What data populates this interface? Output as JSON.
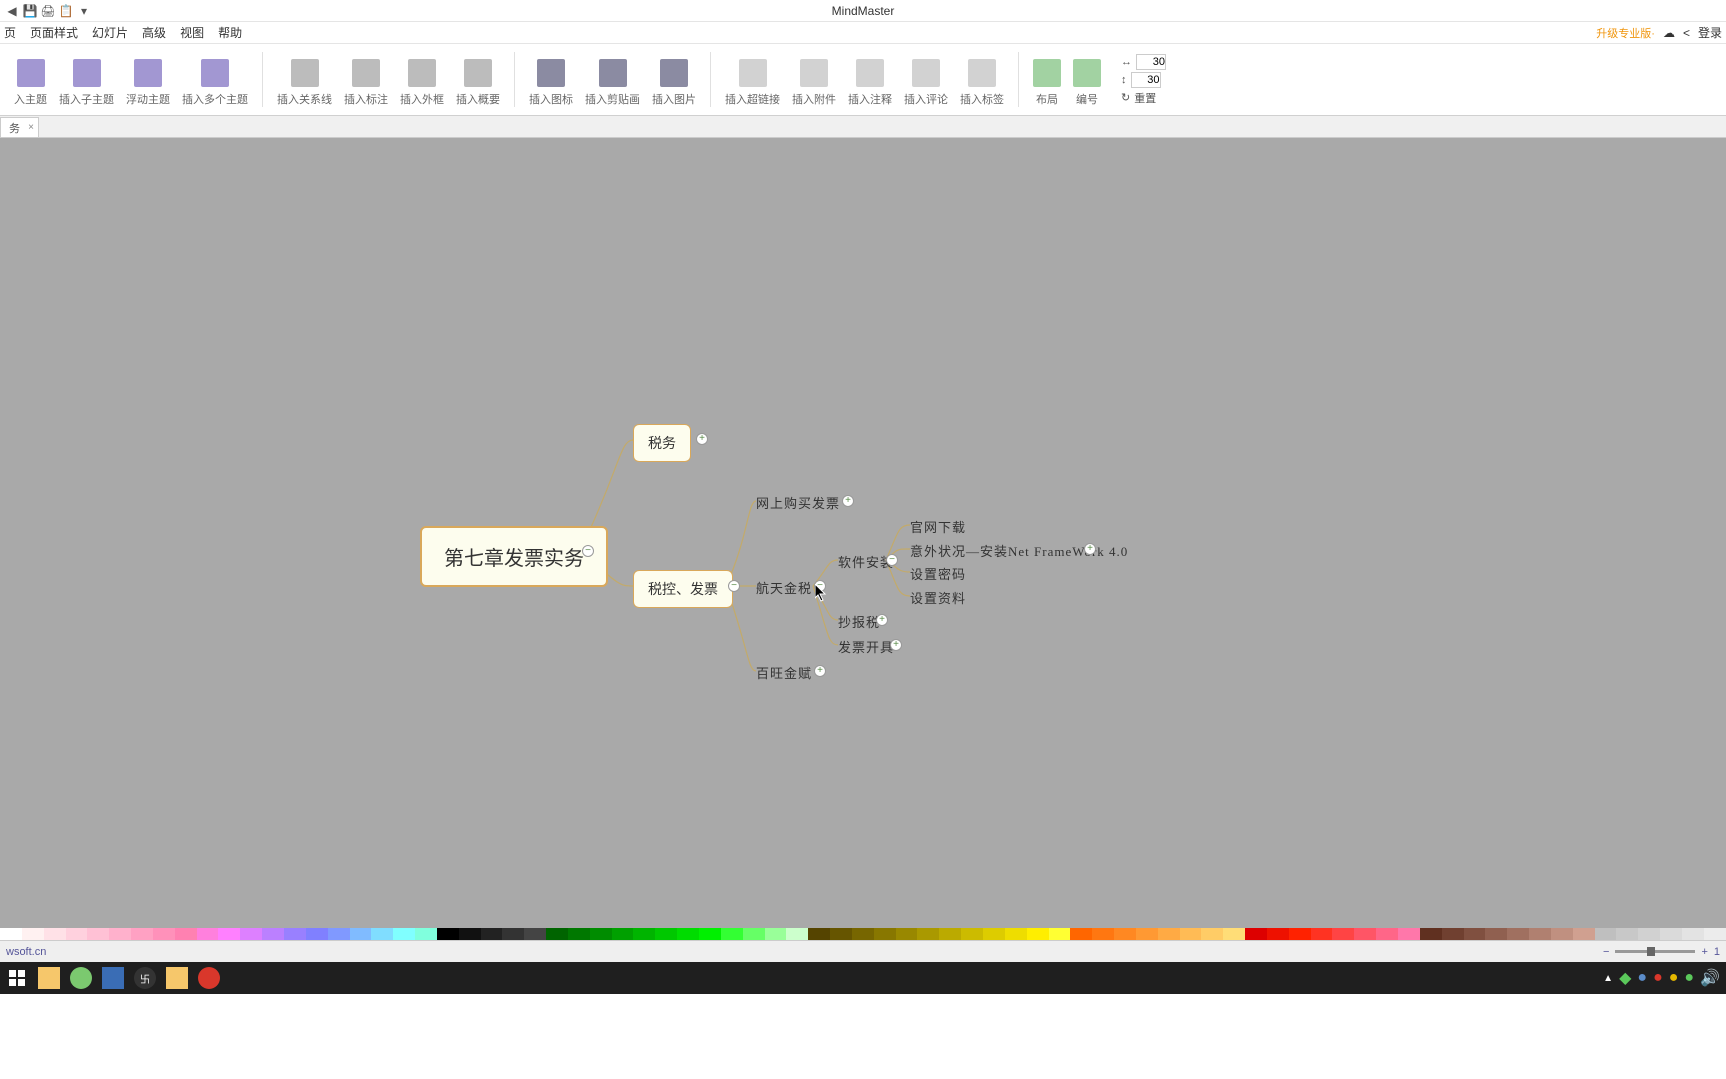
{
  "app": {
    "title": "MindMaster"
  },
  "qat": [
    "◀",
    "💾",
    "🖨",
    "📋",
    "▾"
  ],
  "menu": {
    "items": [
      "页",
      "页面样式",
      "幻灯片",
      "高级",
      "视图",
      "帮助"
    ],
    "upgrade": "升级专业版·",
    "login": "登录"
  },
  "ribbon": {
    "groups": [
      [
        "入主题",
        "插入子主题",
        "浮动主题",
        "插入多个主题"
      ],
      [
        "插入关系线",
        "插入标注",
        "插入外框",
        "插入概要"
      ],
      [
        "插入图标",
        "插入剪贴画",
        "插入图片"
      ],
      [
        "插入超链接",
        "插入附件",
        "插入注释",
        "插入评论",
        "插入标签"
      ],
      [
        "布局",
        "编号"
      ]
    ],
    "spin": {
      "h": "30",
      "v": "30",
      "reset": "重置"
    }
  },
  "tab": {
    "name": "务",
    "close": "×"
  },
  "mindmap": {
    "root": "第七章发票实务",
    "a": "税务",
    "b": "税控、发票",
    "b1": "网上购买发票",
    "b2": "航天金税",
    "b21": "软件安装",
    "b211": "官网下载",
    "b212": "意外状况—安装Net FrameWork 4.0",
    "b213": "设置密码",
    "b214": "设置资料",
    "b22": "抄报税",
    "b23": "发票开具",
    "b3": "百旺金赋"
  },
  "status": {
    "link": "wsoft.cn",
    "zoom": "1"
  },
  "colors": [
    "#fff",
    "#fff1f1",
    "#ffe1e7",
    "#ffd1de",
    "#ffc1d5",
    "#ffb1cc",
    "#ffa1c3",
    "#ff91ba",
    "#ff81b1",
    "#ff80dd",
    "#ff80ff",
    "#dd80ff",
    "#bb80ff",
    "#9980ff",
    "#8080ff",
    "#8099ff",
    "#80bbff",
    "#80ddff",
    "#80ffff",
    "#80ffdd",
    "#000000",
    "#111",
    "#222",
    "#333",
    "#444",
    "#006400",
    "#007800",
    "#008c00",
    "#00a000",
    "#00b400",
    "#00c800",
    "#00dc00",
    "#00f000",
    "#33ff33",
    "#66ff66",
    "#99ff99",
    "#ccffcc",
    "#554400",
    "#665500",
    "#776600",
    "#887700",
    "#998800",
    "#aa9900",
    "#bbaa00",
    "#ccbb00",
    "#ddcc00",
    "#eedd00",
    "#ffee00",
    "#ffff33",
    "#ff6600",
    "#ff7711",
    "#ff8822",
    "#ff9933",
    "#ffaa44",
    "#ffbb55",
    "#ffcc66",
    "#ffdd77",
    "#dd0000",
    "#ee1100",
    "#ff2200",
    "#ff3322",
    "#ff4444",
    "#ff5566",
    "#ff6688",
    "#ff77aa",
    "#603020",
    "#704030",
    "#805040",
    "#906050",
    "#a07060",
    "#b08070",
    "#c09080",
    "#d0a090",
    "#bfbfbf",
    "#c8c8c8",
    "#d1d1d1",
    "#dadada",
    "#e3e3e3",
    "#ececec"
  ]
}
